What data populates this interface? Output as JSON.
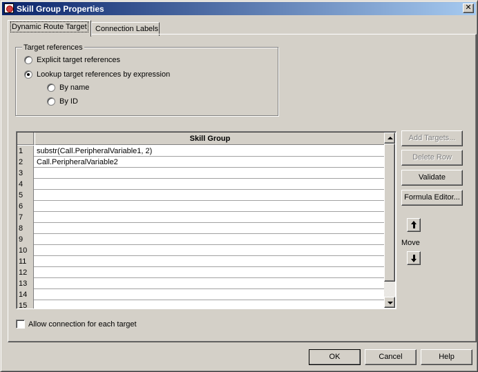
{
  "window": {
    "title": "Skill Group Properties",
    "close_glyph": "✕"
  },
  "tabs": [
    {
      "label": "Dynamic Route Target",
      "active": true
    },
    {
      "label": "Connection Labels",
      "active": false
    }
  ],
  "target_references": {
    "group_label": "Target references",
    "explicit": {
      "label": "Explicit target references",
      "checked": false
    },
    "lookup": {
      "label": "Lookup target references by expression",
      "checked": true
    },
    "by_name": {
      "label": "By name",
      "checked": false
    },
    "by_id": {
      "label": "By ID",
      "checked": false
    }
  },
  "grid": {
    "column_header": "Skill Group",
    "rows": [
      {
        "num": "1",
        "value": "substr(Call.PeripheralVariable1,  2)"
      },
      {
        "num": "2",
        "value": "Call.PeripheralVariable2"
      },
      {
        "num": "3",
        "value": ""
      },
      {
        "num": "4",
        "value": ""
      },
      {
        "num": "5",
        "value": ""
      },
      {
        "num": "6",
        "value": ""
      },
      {
        "num": "7",
        "value": ""
      },
      {
        "num": "8",
        "value": ""
      },
      {
        "num": "9",
        "value": ""
      },
      {
        "num": "10",
        "value": ""
      },
      {
        "num": "11",
        "value": ""
      },
      {
        "num": "12",
        "value": ""
      },
      {
        "num": "13",
        "value": ""
      },
      {
        "num": "14",
        "value": ""
      },
      {
        "num": "15",
        "value": ""
      }
    ]
  },
  "side_buttons": {
    "add_targets": "Add Targets...",
    "delete_row": "Delete Row",
    "validate": "Validate",
    "formula_editor": "Formula Editor...",
    "move_label": "Move"
  },
  "allow_connection": {
    "label": "Allow connection for each target",
    "checked": false
  },
  "footer": {
    "ok": "OK",
    "cancel": "Cancel",
    "help": "Help"
  }
}
